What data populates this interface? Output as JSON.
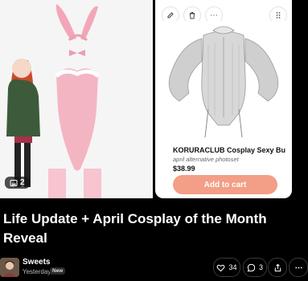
{
  "gallery": {
    "photo_count": "2"
  },
  "product": {
    "title": "KORURACLUB Cosplay Sexy Bunn...",
    "subtitle": "april alternative photoset",
    "price": "$38.99",
    "cta": "Add to cart",
    "cta_color": "#f39e86"
  },
  "post": {
    "title": "Life Update + April Cosplay of the Month Reveal"
  },
  "author": {
    "name": "Sweets",
    "time": "Yesterday",
    "badge": "New"
  },
  "actions": {
    "likes": "34",
    "comments": "3"
  },
  "icons": [
    "image-icon",
    "edit-icon",
    "trash-icon",
    "more-icon",
    "drag-handle-icon",
    "heart-icon",
    "comment-icon",
    "share-icon",
    "more-horizontal-icon"
  ]
}
